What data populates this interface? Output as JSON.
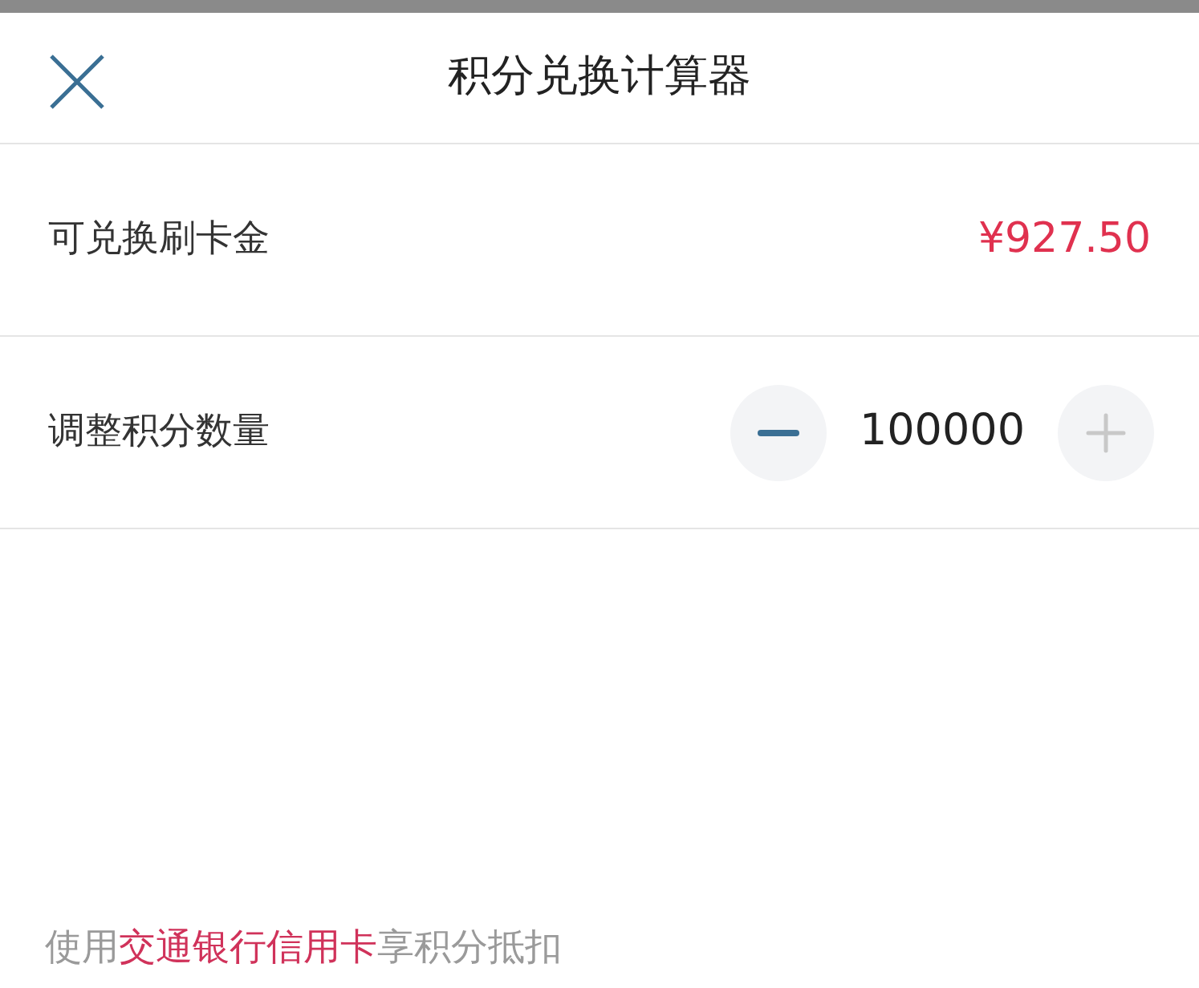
{
  "header": {
    "title": "积分兑换计算器"
  },
  "rows": [
    {
      "kind": "amount",
      "label": "可兑换刷卡金",
      "value": "¥927.50"
    },
    {
      "kind": "stepper",
      "label": "调整积分数量",
      "value": "100000",
      "decrease_disabled": false,
      "increase_disabled": true
    }
  ],
  "footer": {
    "parts": [
      {
        "text": "使用",
        "highlight": false
      },
      {
        "text": "交通银行信用卡",
        "highlight": true
      },
      {
        "text": "享积分抵扣",
        "highlight": false
      }
    ]
  }
}
